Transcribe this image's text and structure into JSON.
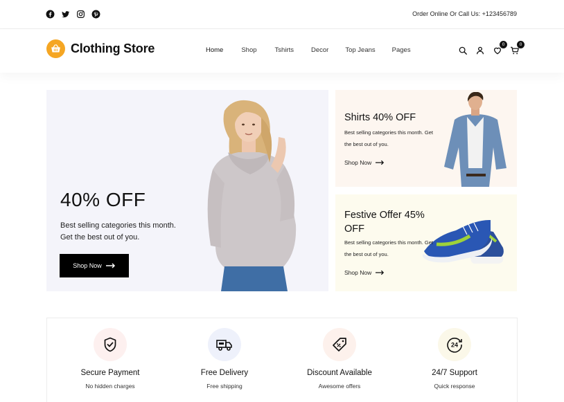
{
  "topbar": {
    "social": [
      "facebook-icon",
      "twitter-icon",
      "instagram-icon",
      "pinterest-icon"
    ],
    "contact": "Order Online Or Call Us: +123456789"
  },
  "header": {
    "brand": "Clothing Store",
    "nav": [
      "Home",
      "Shop",
      "Tshirts",
      "Decor",
      "Top Jeans",
      "Pages"
    ],
    "wishlist_count": "0",
    "cart_count": "0"
  },
  "hero": {
    "title": "40% OFF",
    "description": "Best selling categories this month. Get the best out of you.",
    "button": "Shop Now"
  },
  "cards": [
    {
      "title": "Shirts 40% OFF",
      "description": "Best selling categories this month. Get the best out of you.",
      "link": "Shop Now"
    },
    {
      "title": "Festive Offer 45% OFF",
      "description": "Best selling categories this month. Get the best out of you.",
      "link": "Shop Now"
    }
  ],
  "features": [
    {
      "title": "Secure Payment",
      "subtitle": "No hidden charges",
      "icon": "shield-check-icon",
      "bg": "#fdf0ef"
    },
    {
      "title": "Free Delivery",
      "subtitle": "Free shipping",
      "icon": "truck-icon",
      "bg": "#eef1fb"
    },
    {
      "title": "Discount Available",
      "subtitle": "Awesome offers",
      "icon": "discount-tag-icon",
      "bg": "#fdf1ec"
    },
    {
      "title": "24/7 Support",
      "subtitle": "Quick response",
      "icon": "support-24-icon",
      "bg": "#fbf8e9"
    }
  ],
  "colors": {
    "brand": "#f5a623",
    "dark": "#000000",
    "hero_bg": "#f4f4fa",
    "card1_bg": "#fdf6f0",
    "card2_bg": "#fdfbee"
  }
}
